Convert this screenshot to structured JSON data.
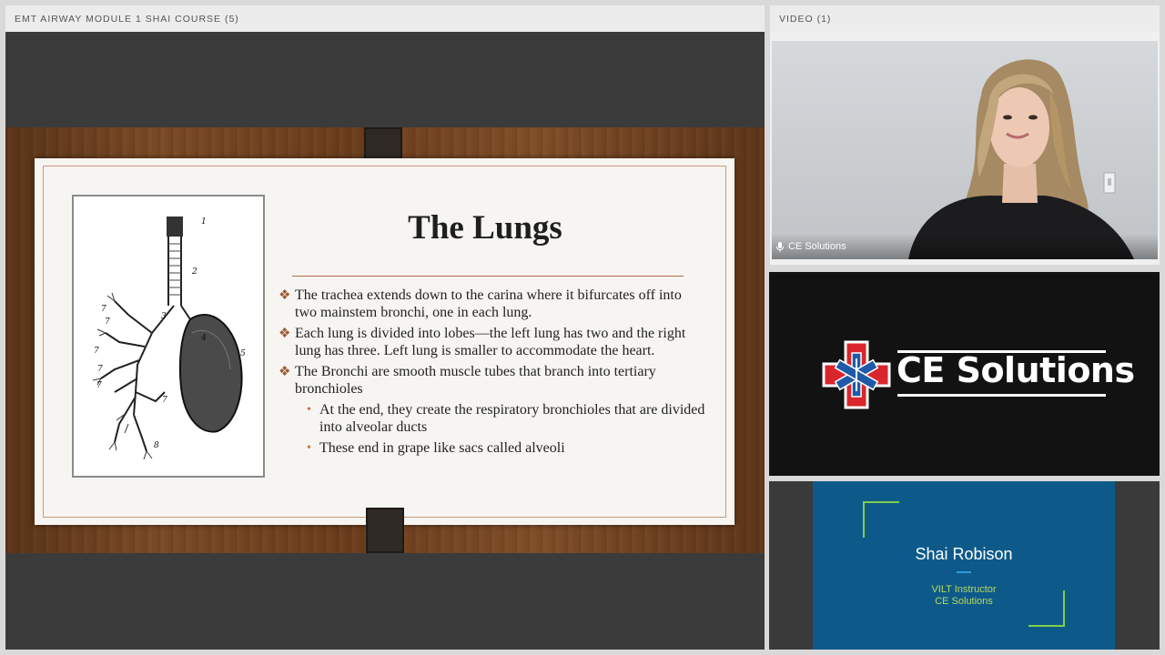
{
  "left_panel": {
    "title": "EMT AIRWAY MODULE 1 SHAI COURSE (5)"
  },
  "slide": {
    "title": "The Lungs",
    "diagram_labels": [
      "1",
      "2",
      "3",
      "4",
      "5",
      "7",
      "7",
      "7",
      "7",
      "7",
      "7",
      "8"
    ],
    "bullets": [
      {
        "text": "The trachea extends down to the carina where it bifurcates off into two mainstem bronchi, one in each lung.",
        "sub": []
      },
      {
        "text": "Each lung is divided into lobes—the left lung has two and the right lung has three. Left lung is smaller to accommodate the heart.",
        "sub": []
      },
      {
        "text": "The Bronchi are smooth muscle tubes that branch into tertiary bronchioles",
        "sub": [
          "At the end, they create the respiratory bronchioles that are divided into alveolar ducts",
          "These end in grape like sacs called alveoli"
        ]
      }
    ]
  },
  "video_panel": {
    "title": "VIDEO (1)",
    "participant_name": "CE Solutions",
    "mic_icon": "microphone-icon"
  },
  "logo_tile": {
    "brand_text": "CE Solutions",
    "icon": "star-of-life-icon",
    "colors": {
      "cross": "#d8262c",
      "star": "#1e5aa8"
    }
  },
  "presenter_card": {
    "name": "Shai Robison",
    "role": "VILT Instructor",
    "org": "CE Solutions"
  }
}
